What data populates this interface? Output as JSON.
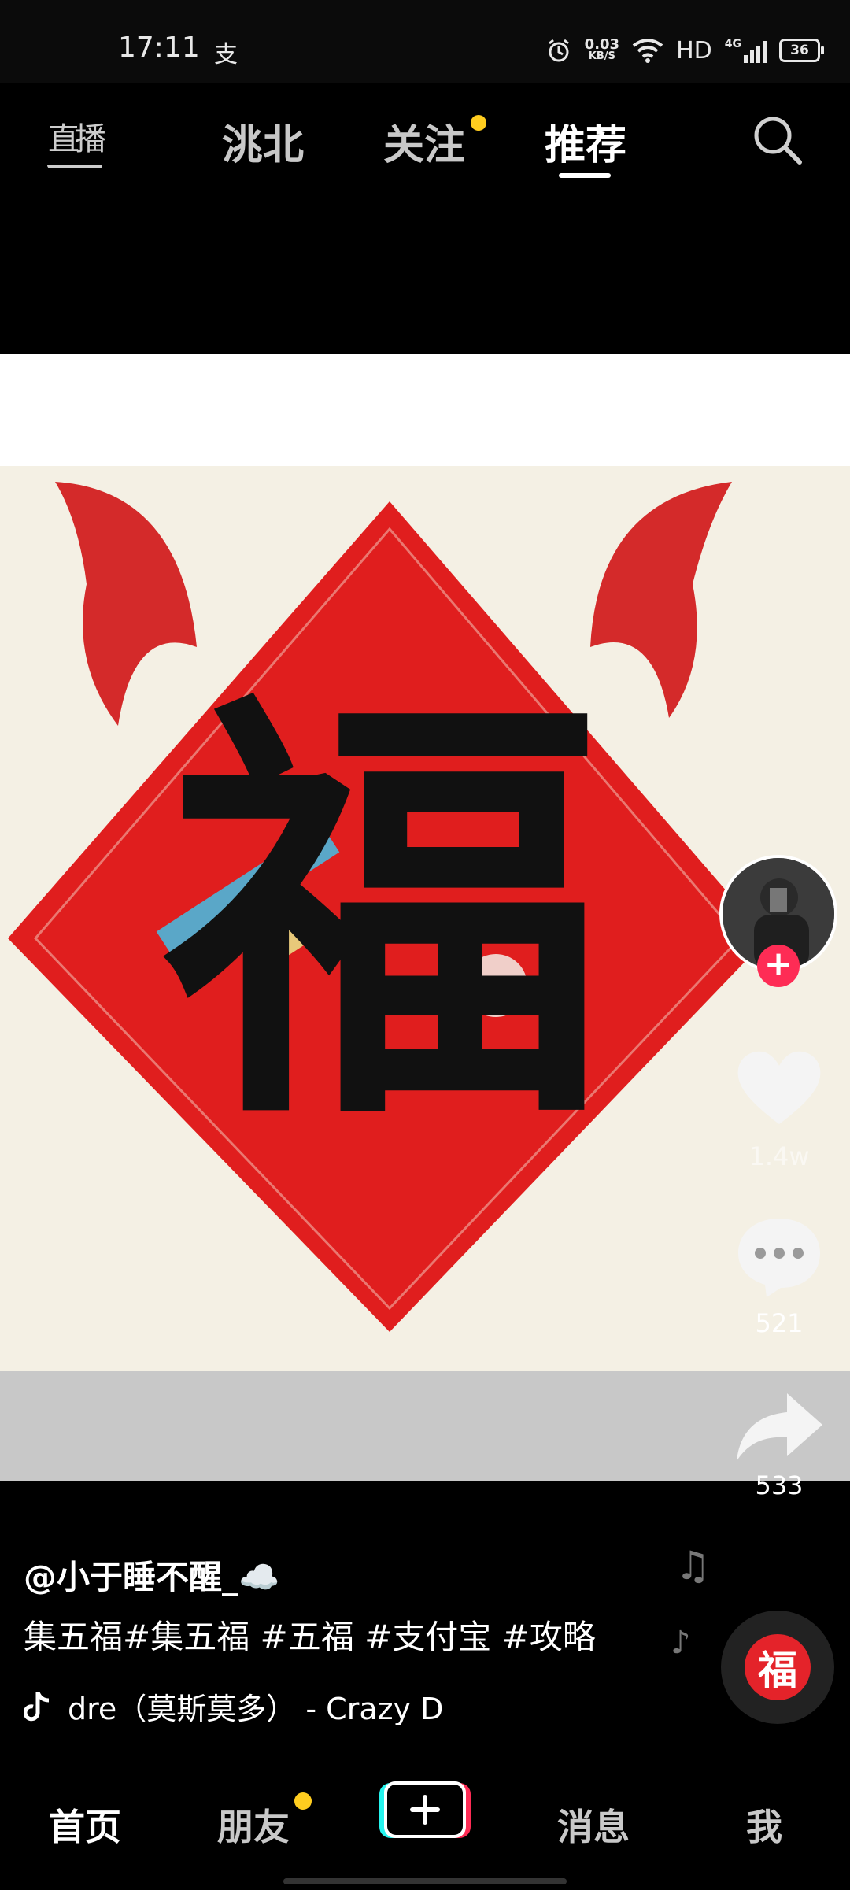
{
  "status_bar": {
    "time": "17:11",
    "pay_glyph": "支",
    "net_speed": "0.03",
    "net_unit": "KB/S",
    "hd": "HD",
    "signal_label": "4G",
    "battery": "36"
  },
  "top_nav": {
    "live_label": "直播",
    "tabs": [
      {
        "label": "洮北"
      },
      {
        "label": "关注"
      },
      {
        "label": "推荐"
      }
    ],
    "active_tab": "推荐"
  },
  "video": {
    "character": "福"
  },
  "actions": {
    "like_count": "1.4w",
    "comment_count": "521",
    "share_count": "533"
  },
  "caption": {
    "author": "@小于睡不醒_☁️",
    "text": "集五福#集五福 #五福 #支付宝 #攻略",
    "music": "dre（莫斯莫多） - Crazy D",
    "disc_glyph": "福"
  },
  "bottom_nav": {
    "home": "首页",
    "friends": "朋友",
    "create": "+",
    "messages": "消息",
    "me": "我"
  },
  "colors": {
    "accent_red": "#fe2c55",
    "notify_yellow": "#ffcd1f",
    "fu_red": "#e4232a"
  }
}
